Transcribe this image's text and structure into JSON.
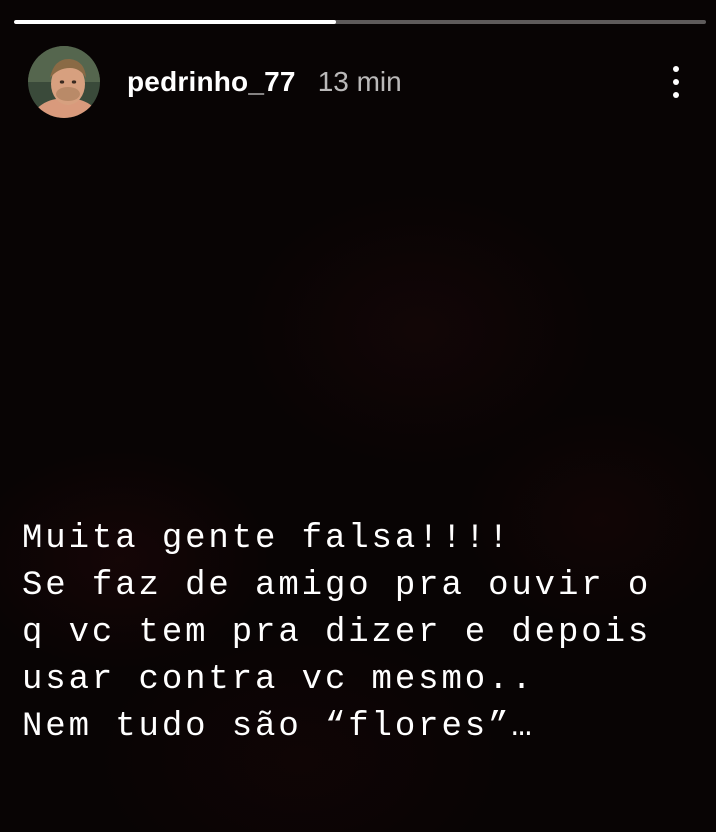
{
  "story": {
    "progress": 0.465,
    "user": {
      "username": "pedrinho_77",
      "time_ago": "13 min",
      "avatar_icon": "profile-photo"
    },
    "menu_icon": "more-vertical-icon",
    "text_lines": [
      "Muita gente falsa!!!!",
      "Se faz de amigo pra ouvir o",
      "q vc tem pra dizer e depois",
      "usar contra vc mesmo..",
      "Nem tudo são “flores”…"
    ]
  }
}
